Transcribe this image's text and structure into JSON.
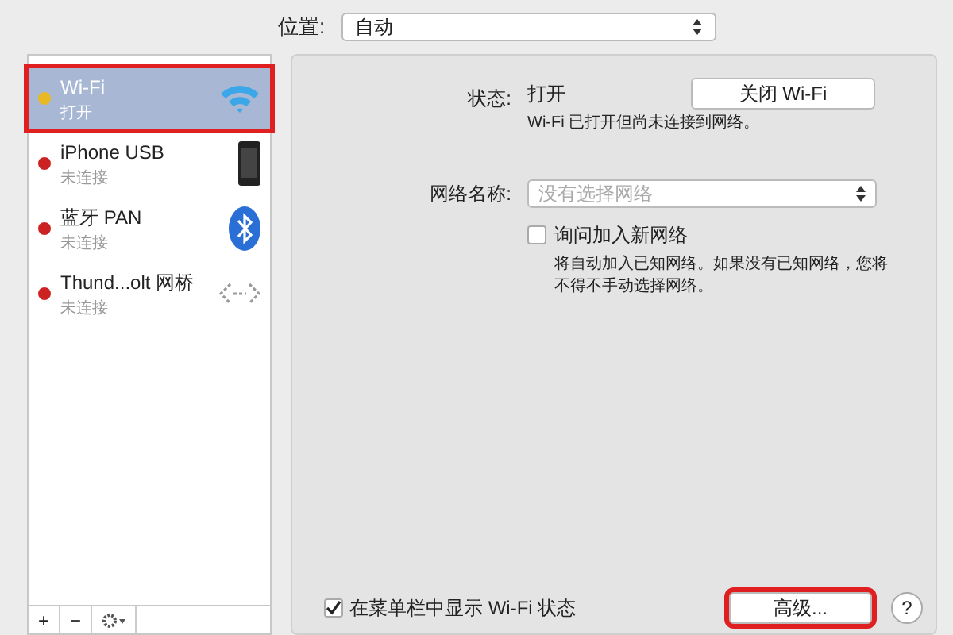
{
  "location": {
    "label": "位置:",
    "value": "自动"
  },
  "services": [
    {
      "name": "Wi-Fi",
      "status": "打开",
      "color": "#e8b923",
      "kind": "wifi",
      "selected": true,
      "highlighted": true
    },
    {
      "name": "iPhone USB",
      "status": "未连接",
      "color": "#cc2222",
      "kind": "phone",
      "selected": false,
      "highlighted": false
    },
    {
      "name": "蓝牙 PAN",
      "status": "未连接",
      "color": "#cc2222",
      "kind": "bluetooth",
      "selected": false,
      "highlighted": false
    },
    {
      "name": "Thund...olt 网桥",
      "status": "未连接",
      "color": "#cc2222",
      "kind": "bridge",
      "selected": false,
      "highlighted": false
    }
  ],
  "sidebar_toolbar": [
    "+",
    "−"
  ],
  "status": {
    "label": "状态:",
    "value": "打开",
    "button": "关闭 Wi-Fi",
    "note": "Wi-Fi 已打开但尚未连接到网络。"
  },
  "network": {
    "label": "网络名称:",
    "placeholder": "没有选择网络"
  },
  "ask_join": {
    "label": "询问加入新网络",
    "checked": false,
    "note": "将自动加入已知网络。如果没有已知网络，您将不得不手动选择网络。"
  },
  "show_in_menu": {
    "label": "在菜单栏中显示 Wi-Fi 状态",
    "checked": true
  },
  "advanced_button": {
    "label": "高级...",
    "highlighted": true
  },
  "help_button": "?"
}
